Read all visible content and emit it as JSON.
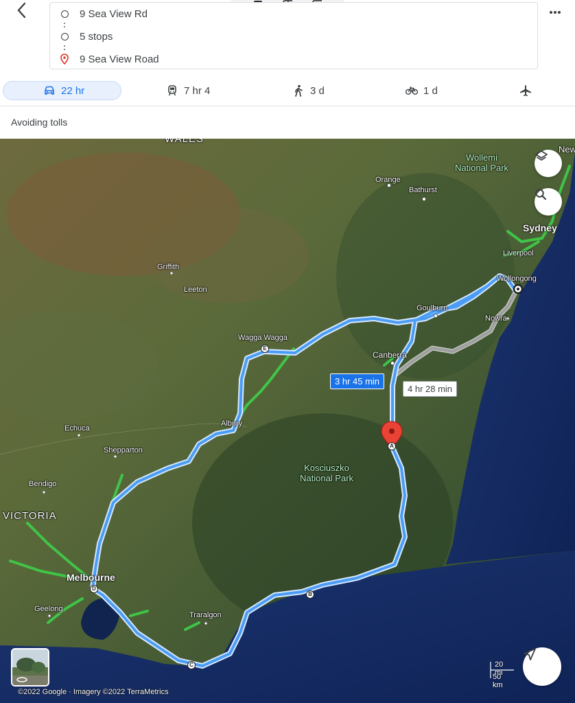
{
  "header": {
    "back_icon": "arrow-back-icon",
    "more_icon": "more-horiz-icon",
    "origin": "9 Sea View Rd",
    "stops": "5 stops",
    "destination": "9 Sea View Road"
  },
  "modes": [
    {
      "icon": "car-icon",
      "label": "22 hr",
      "active": true
    },
    {
      "icon": "train-icon",
      "label": "7 hr 4"
    },
    {
      "icon": "walk-icon",
      "label": "3 d"
    },
    {
      "icon": "bike-icon",
      "label": "1 d"
    },
    {
      "icon": "flight-icon",
      "label": ""
    }
  ],
  "route_options": "Avoiding tolls",
  "map": {
    "labels": {
      "wales": "WALES",
      "wollemi": "Wollemi\nNational Park",
      "new": "New",
      "orange": "Orange",
      "bathurst": "Bathurst",
      "sydney": "Sydney",
      "liverpool": "Liverpool",
      "wollongong": "Wollongong",
      "griffith": "Griffith",
      "leeton": "Leeton",
      "goulburn": "Goulburn",
      "nowra": "Nowra",
      "wagga": "Wagga Wagga",
      "canberra": "Canberra",
      "albury": "Albury",
      "echuca": "Echuca",
      "shepparton": "Shepparton",
      "kosciuszko": "Kosciuszko\nNational Park",
      "bendigo": "Bendigo",
      "victoria": "VICTORIA",
      "melbourne": "Melbourne",
      "geelong": "Geelong",
      "traralgon": "Traralgon"
    },
    "stops": [
      "A",
      "B",
      "C",
      "D",
      "E"
    ],
    "primary_duration": "3 hr 45 min",
    "alternate_duration": "4 hr 28 min",
    "scale_mi": "20 mi",
    "scale_km": "50 km",
    "copyright": "©2022 Google · Imagery ©2022 TerraMetrics",
    "colors": {
      "route": "#4a9cf5",
      "route_outline": "#d6e8ff",
      "traffic": "#3ecf4a",
      "alt_route": "#b0b0b0"
    }
  }
}
